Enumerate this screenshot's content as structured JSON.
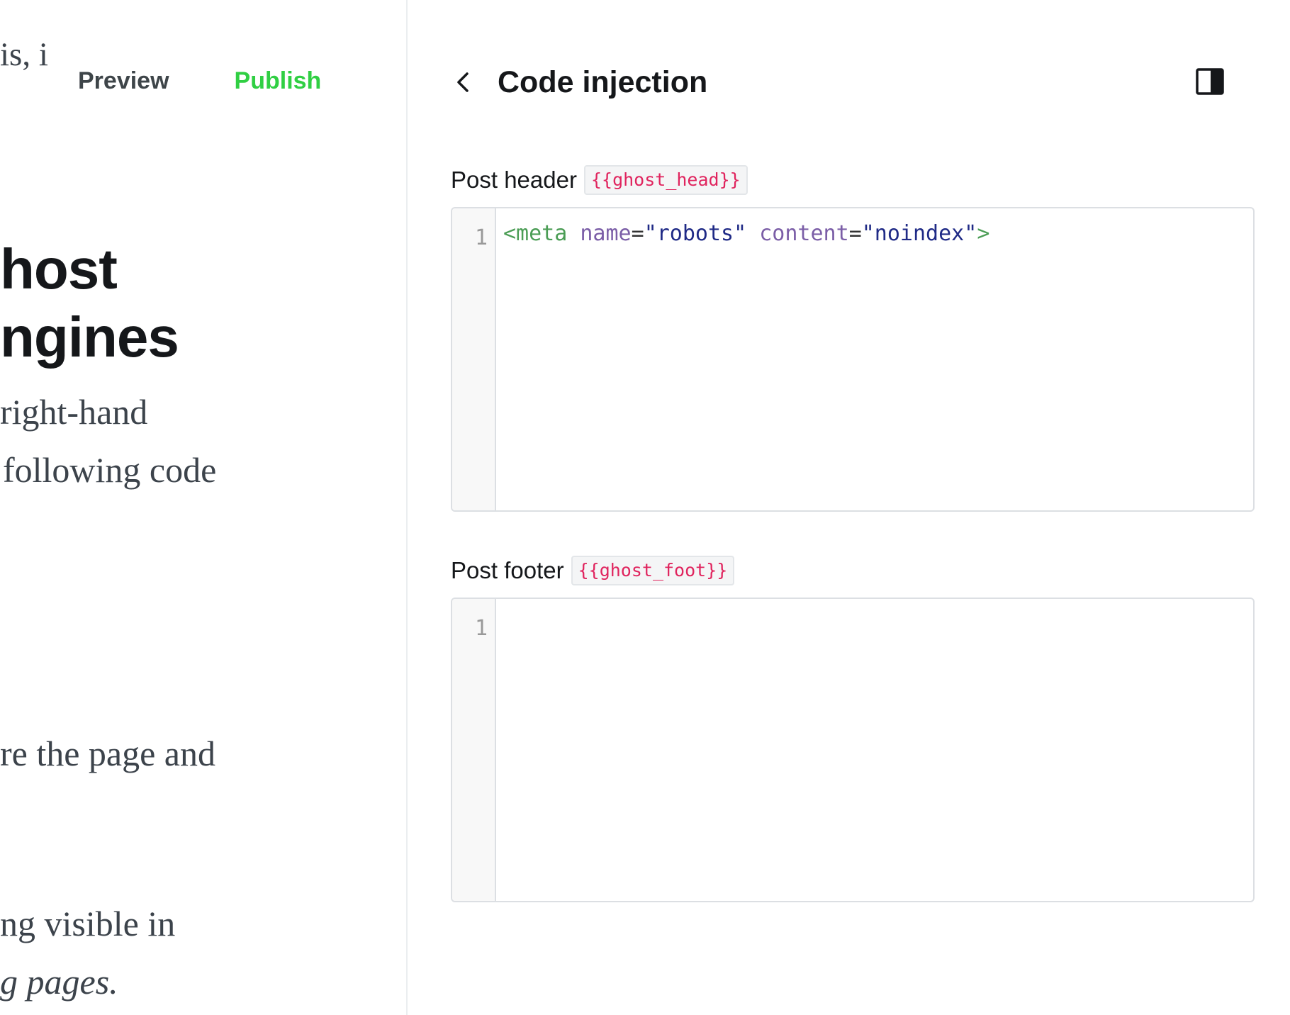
{
  "editor": {
    "snippet_top": "is, i",
    "heading_line1": "host",
    "heading_line2": "ngines",
    "body_lines": [
      "right-hand",
      "following code",
      "re the page and",
      "ng visible in",
      "g pages."
    ],
    "actions": {
      "preview_label": "Preview",
      "publish_label": "Publish"
    }
  },
  "panel": {
    "title": "Code injection",
    "back_icon": "chevron-left-icon",
    "toggle_icon": "sidebar-toggle-icon",
    "header_field": {
      "label": "Post header",
      "tag": "{{ghost_head}}",
      "line_number": "1",
      "code_tokens": {
        "open": "<meta",
        "attr1": "name",
        "eq1": "=",
        "val1": "\"robots\"",
        "attr2": "content",
        "eq2": "=",
        "val2": "\"noindex\"",
        "close": ">"
      }
    },
    "footer_field": {
      "label": "Post footer",
      "tag": "{{ghost_foot}}",
      "line_number": "1",
      "code": ""
    }
  },
  "colors": {
    "publish": "#30cf43",
    "tag_text": "#e0245e",
    "code_tag": "#4b9d55",
    "code_attr": "#7b5ea7",
    "code_string": "#1f2a86"
  }
}
